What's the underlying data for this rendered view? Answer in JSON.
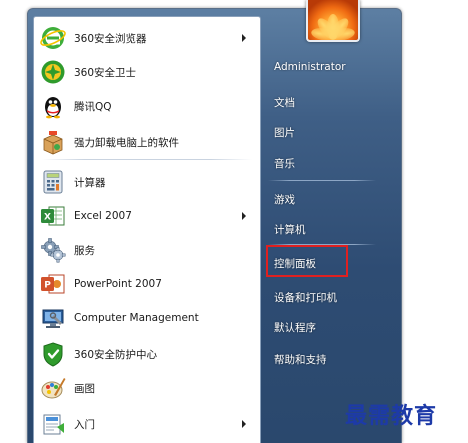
{
  "start_menu": {
    "programs": [
      {
        "label": "360安全浏览器",
        "icon": "ie-browser-icon",
        "has_submenu": true
      },
      {
        "label": "360安全卫士",
        "icon": "360-guard-icon",
        "has_submenu": false
      },
      {
        "label": "腾讯QQ",
        "icon": "qq-penguin-icon",
        "has_submenu": false
      },
      {
        "label": "强力卸载电脑上的软件",
        "icon": "uninstall-box-icon",
        "has_submenu": false
      },
      {
        "label": "计算器",
        "icon": "calculator-icon",
        "has_submenu": false
      },
      {
        "label": "Excel 2007",
        "icon": "excel-icon",
        "has_submenu": true
      },
      {
        "label": "服务",
        "icon": "services-gear-icon",
        "has_submenu": false
      },
      {
        "label": "PowerPoint 2007",
        "icon": "powerpoint-icon",
        "has_submenu": false
      },
      {
        "label": "Computer Management",
        "icon": "computer-management-icon",
        "has_submenu": false
      },
      {
        "label": "360安全防护中心",
        "icon": "shield-icon",
        "has_submenu": false
      },
      {
        "label": "画图",
        "icon": "paint-icon",
        "has_submenu": false
      },
      {
        "label": "入门",
        "icon": "getting-started-icon",
        "has_submenu": true
      }
    ],
    "right": {
      "user": "Administrator",
      "links": [
        "文档",
        "图片",
        "音乐",
        "游戏",
        "计算机",
        "控制面板",
        "设备和打印机",
        "默认程序",
        "帮助和支持"
      ],
      "highlighted": "控制面板"
    }
  },
  "watermark": "最需教育",
  "colors": {
    "highlight_border": "#e02020",
    "menu_blue": "#2e4c73",
    "watermark": "#1d3aa8"
  }
}
